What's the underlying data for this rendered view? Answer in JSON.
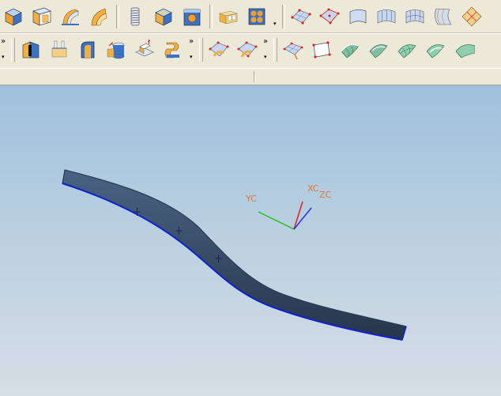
{
  "toolbar": {
    "row1": {
      "buttons": [
        {
          "name": "block-tool",
          "icon": "block-icon"
        },
        {
          "name": "extrude-tool",
          "icon": "extrude-icon"
        },
        {
          "name": "revolve-tool",
          "icon": "revolve-icon"
        },
        {
          "name": "sweep-tool",
          "icon": "sweep-icon"
        },
        {
          "name": "thread-tool",
          "icon": "thread-icon"
        },
        {
          "name": "pocket-tool",
          "icon": "pocket-icon"
        },
        {
          "name": "boss-tool",
          "icon": "boss-icon"
        },
        {
          "name": "pattern-tool",
          "icon": "pattern-icon"
        },
        {
          "name": "hole-array-tool",
          "icon": "hole-array-icon"
        },
        {
          "name": "through-points-tool",
          "icon": "through-points-icon"
        },
        {
          "name": "from-poles-tool",
          "icon": "from-poles-icon"
        },
        {
          "name": "ruled-surface-tool",
          "icon": "ruled-surface-icon"
        },
        {
          "name": "through-curves-tool",
          "icon": "through-curves-icon"
        },
        {
          "name": "curve-mesh-tool",
          "icon": "curve-mesh-icon"
        },
        {
          "name": "swept-surface-tool",
          "icon": "swept-surface-icon"
        },
        {
          "name": "section-surface-tool",
          "icon": "section-surface-icon"
        }
      ],
      "overflow_chevron": "»"
    },
    "row2": {
      "buttons_a": [
        {
          "name": "blend-tool",
          "icon": "blend-icon"
        },
        {
          "name": "offset-tool",
          "icon": "offset-icon"
        },
        {
          "name": "shell-tool",
          "icon": "shell-icon"
        },
        {
          "name": "trim-body-tool",
          "icon": "trim-body-icon"
        },
        {
          "name": "draft-tool",
          "icon": "draft-icon"
        },
        {
          "name": "sew-tool",
          "icon": "sew-icon"
        }
      ],
      "buttons_b": [
        {
          "name": "edit-poles-tool",
          "icon": "edit-poles-icon"
        },
        {
          "name": "change-degree-tool",
          "icon": "change-degree-icon"
        }
      ],
      "buttons_c": [
        {
          "name": "move-pole-tool",
          "icon": "move-pole-icon"
        },
        {
          "name": "bounded-plane-tool",
          "icon": "bounded-plane-icon"
        },
        {
          "name": "offset-surface-tool",
          "icon": "offset-surface-icon"
        },
        {
          "name": "trim-sheet-tool",
          "icon": "trim-sheet-icon"
        },
        {
          "name": "extend-surface-tool",
          "icon": "extend-surface-icon"
        },
        {
          "name": "blend-surface-tool",
          "icon": "blend-surface-icon"
        },
        {
          "name": "bridge-surface-tool",
          "icon": "bridge-surface-icon"
        }
      ],
      "overflow_chevron": "»",
      "dropdown_arrow": "▾"
    }
  },
  "viewport": {
    "axes": {
      "x_label": "XC",
      "y_label": "YC",
      "z_label": "ZC",
      "x_color": "#e02020",
      "y_color": "#20c020",
      "z_color": "#2030e0"
    },
    "model": {
      "strip_color": "#33465e",
      "edge_color": "#1020d0"
    }
  },
  "colors": {
    "toolbar_bg": "#ece9d8",
    "viewport_top": "#9fc0dc",
    "viewport_bottom": "#d6dee6",
    "axis_label": "#e0763a"
  }
}
